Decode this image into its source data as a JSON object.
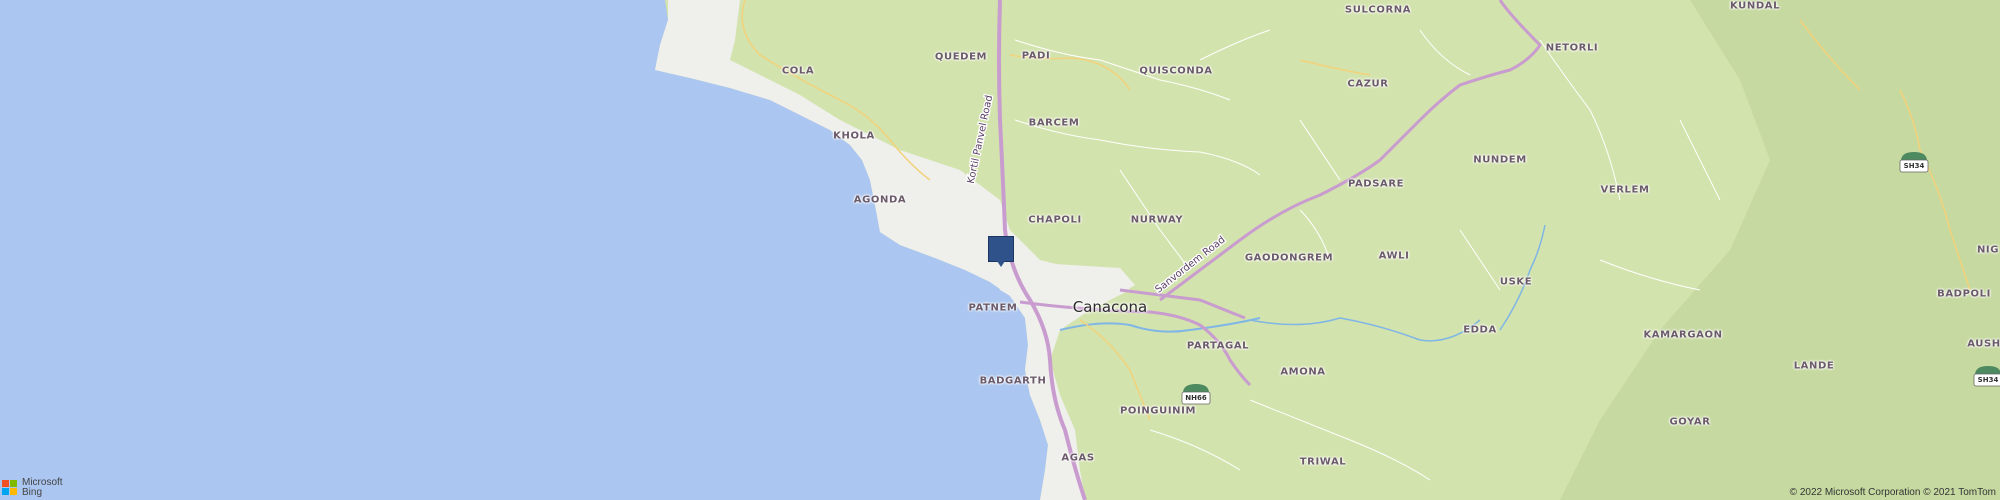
{
  "map": {
    "colors": {
      "water": "#abc6f0",
      "land": "#d3e3ad",
      "built_up": "#efefec",
      "highway": "#c99ccf",
      "secondary_road": "#f2d27a",
      "minor_road": "#ffffff",
      "river": "#7fb6e6",
      "marker": "#2e5289"
    },
    "places": [
      "SULCORNA",
      "KUNDAL",
      "COLA",
      "QUEDEM",
      "PADI",
      "QUISCONDA",
      "CAZUR",
      "NETORLI",
      "KHOLA",
      "BARCEM",
      "NUNDEM",
      "SH34",
      "AGONDA",
      "CHAPOLI",
      "NURWAY",
      "PADSARE",
      "VERLEM",
      "GAODONGREM",
      "AWLI",
      "NIG",
      "USKE",
      "BADPOLI",
      "PATNEM",
      "PARTAGAL",
      "EDDA",
      "KAMARGAON",
      "AUSH",
      "BADGARTH",
      "AMONA",
      "LANDE",
      "NH66",
      "POINGUINIM",
      "GOYAR",
      "AGAS",
      "TRIWAL"
    ],
    "town": "Canacona",
    "roads": [
      "Kortil Panvel Road",
      "Sanvordem Road"
    ],
    "shields": [
      "SH34",
      "NH66",
      "SH34"
    ],
    "marker": {
      "name": "selected-location-pin"
    }
  },
  "attribution": {
    "brand_line1": "Microsoft",
    "brand_line2": "Bing",
    "copyright": "© 2022 Microsoft Corporation © 2021 TomTom"
  }
}
